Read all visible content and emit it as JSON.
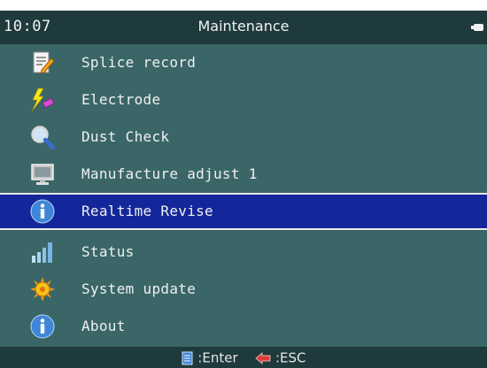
{
  "status_bar": {
    "time": "10:07",
    "title": "Maintenance",
    "battery_icon": "battery-icon"
  },
  "menu": {
    "items": [
      {
        "label": "Splice record",
        "icon": "notepad-pencil-icon",
        "selected": false
      },
      {
        "label": "Electrode",
        "icon": "lightning-electrode-icon",
        "selected": false
      },
      {
        "label": "Dust Check",
        "icon": "magnifier-icon",
        "selected": false
      },
      {
        "label": "Manufacture adjust 1",
        "icon": "monitor-icon",
        "selected": false
      },
      {
        "label": "Realtime Revise",
        "icon": "info-icon",
        "selected": true
      },
      {
        "label": "Status",
        "icon": "signal-bars-icon",
        "selected": false
      },
      {
        "label": "System update",
        "icon": "gear-sun-icon",
        "selected": false
      },
      {
        "label": "About",
        "icon": "info-icon",
        "selected": false
      }
    ]
  },
  "footer": {
    "enter_label": "Enter",
    "esc_label": "ESC",
    "enter_icon": "enter-key-icon",
    "esc_icon": "back-arrow-icon"
  },
  "colors": {
    "bar_bg": "#1f3a3c",
    "menu_bg": "#3a6668",
    "selected_bg": "#14279a",
    "text": "#f0f0f0"
  }
}
